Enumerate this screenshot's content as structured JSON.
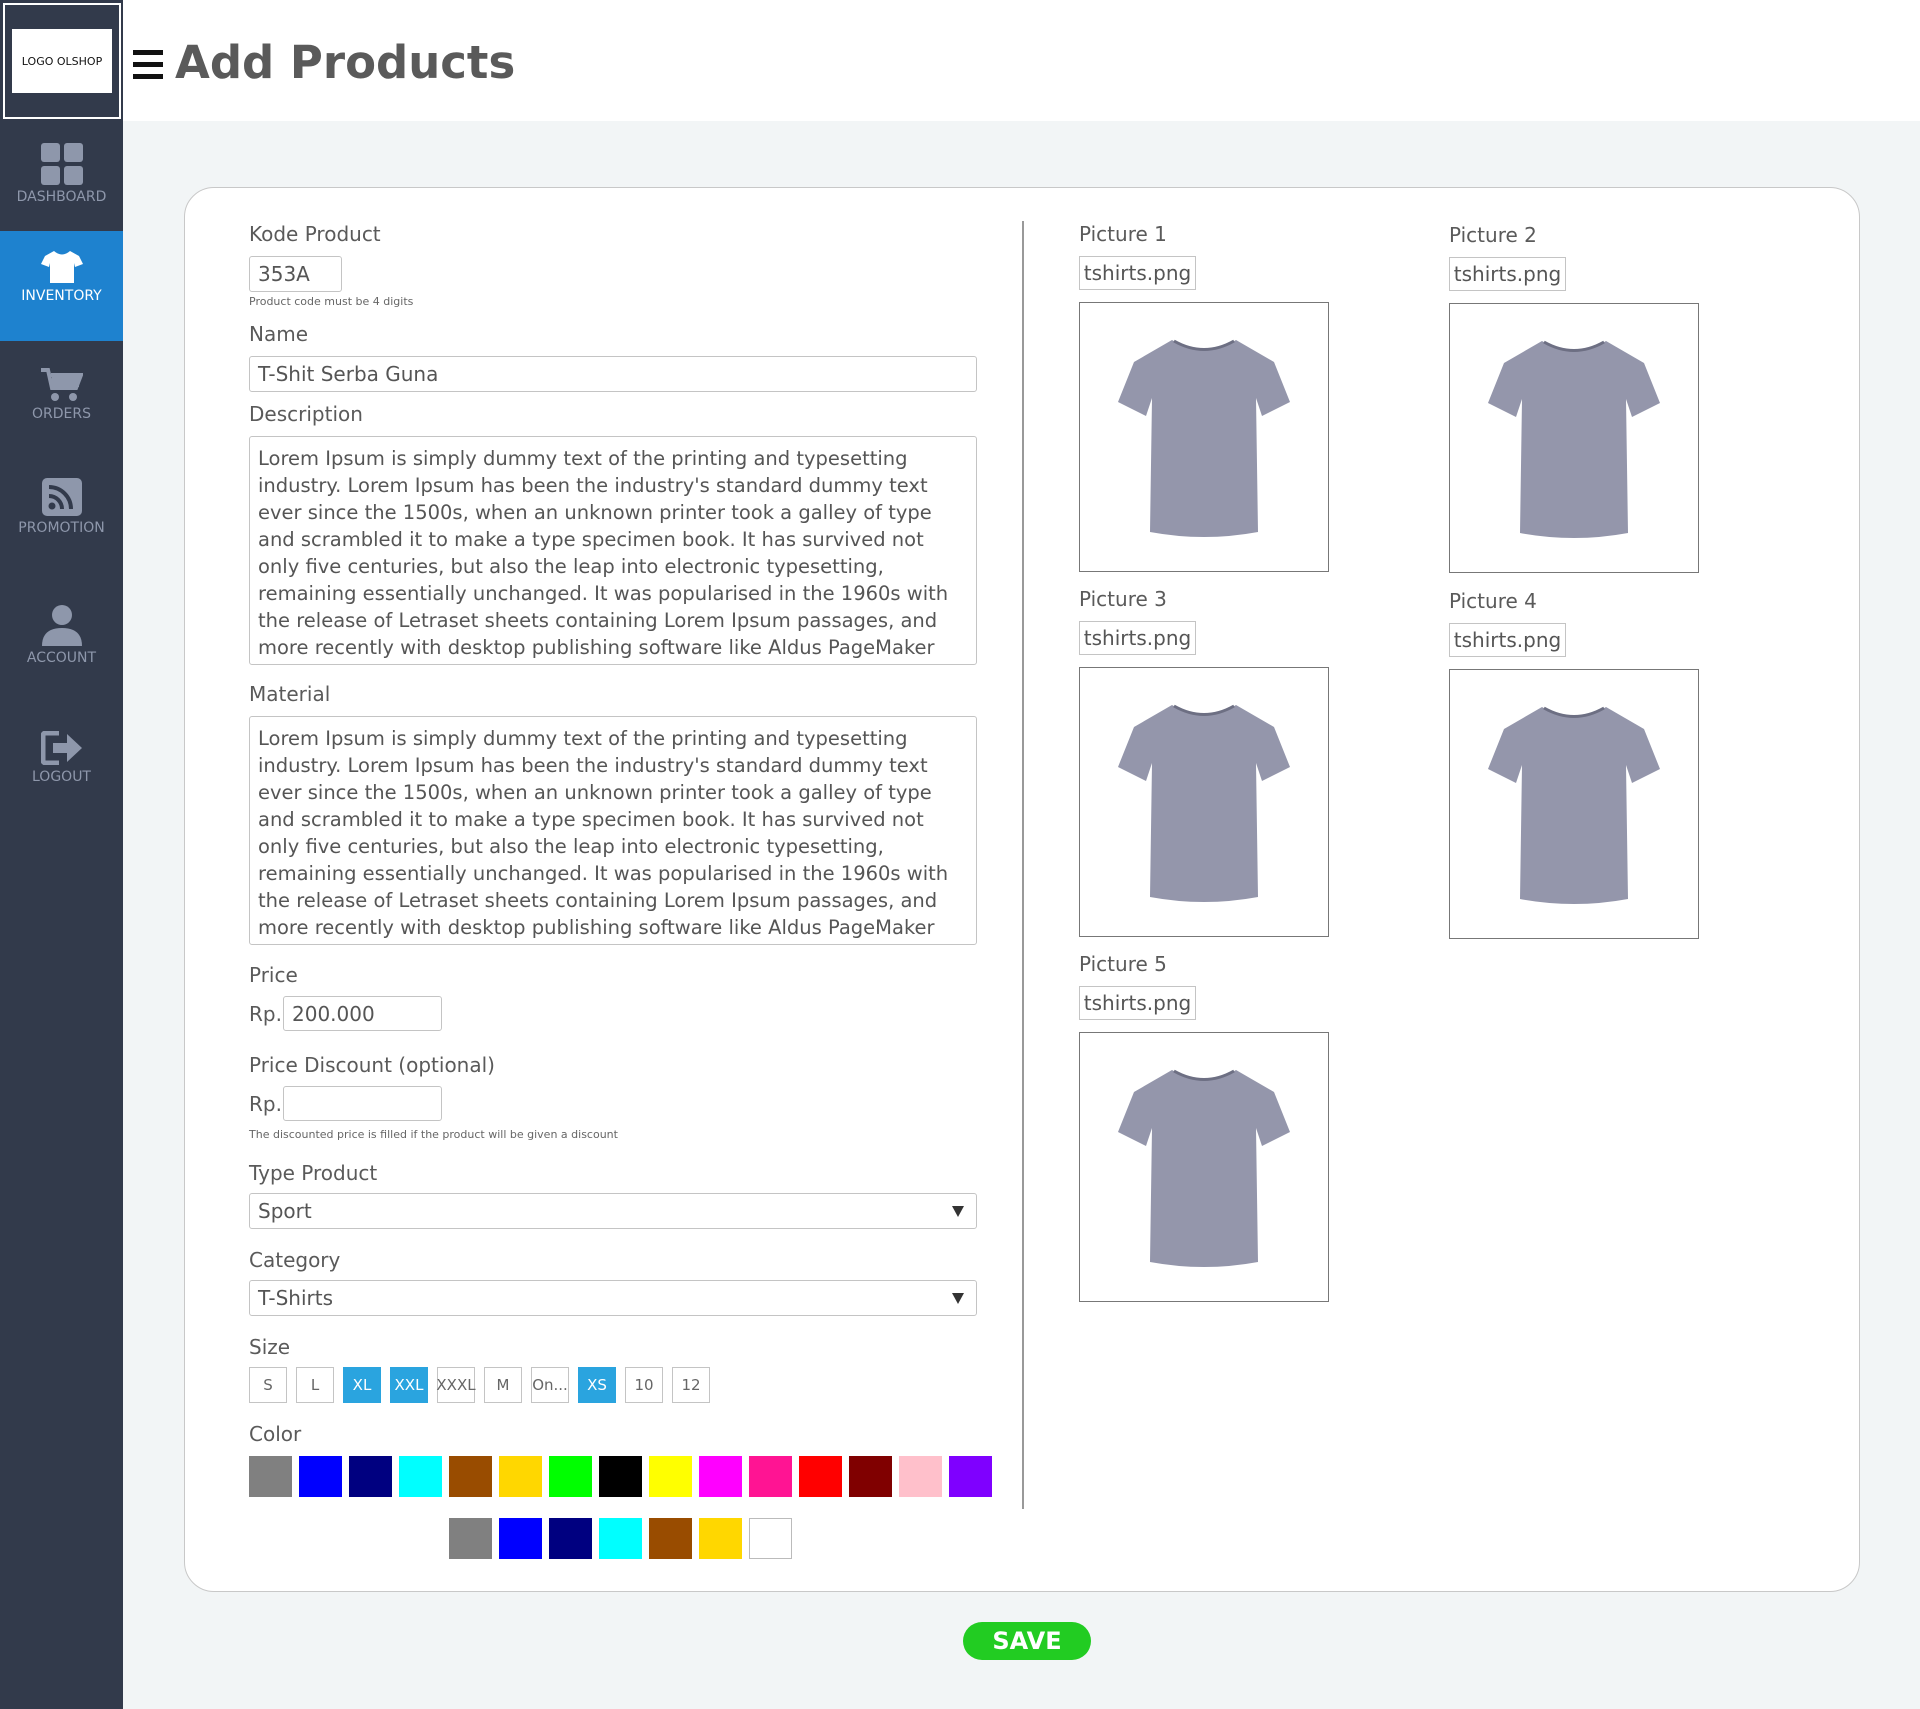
{
  "sidebar": {
    "logo": "LOGO OLSHOP",
    "items": [
      {
        "label": "DASHBOARD",
        "icon": "dashboard-icon"
      },
      {
        "label": "INVENTORY",
        "icon": "tshirt-icon",
        "active": true
      },
      {
        "label": "ORDERS",
        "icon": "cart-icon"
      },
      {
        "label": "PROMOTION",
        "icon": "rss-icon"
      },
      {
        "label": "ACCOUNT",
        "icon": "user-icon"
      },
      {
        "label": "LOGOUT",
        "icon": "logout-icon"
      }
    ]
  },
  "header": {
    "title": "Add Products"
  },
  "form": {
    "kode_label": "Kode Product",
    "kode_value": "353A",
    "kode_hint": "Product code must be 4 digits",
    "name_label": "Name",
    "name_value": "T-Shit Serba Guna",
    "description_label": "Description",
    "description_value": "Lorem Ipsum is simply dummy text of the printing and typesetting industry. Lorem Ipsum has been the industry's standard dummy text ever since the 1500s, when an unknown printer took a galley of type and scrambled it to make a type specimen book. It has survived not only five centuries, but also the leap into electronic typesetting, remaining essentially unchanged. It was popularised in the 1960s with the release of Letraset sheets containing Lorem Ipsum passages, and more recently with desktop publishing software like Aldus PageMaker",
    "material_label": "Material",
    "material_value": "Lorem Ipsum is simply dummy text of the printing and typesetting industry. Lorem Ipsum has been the industry's standard dummy text ever since the 1500s, when an unknown printer took a galley of type and scrambled it to make a type specimen book. It has survived not only five centuries, but also the leap into electronic typesetting, remaining essentially unchanged. It was popularised in the 1960s with the release of Letraset sheets containing Lorem Ipsum passages, and more recently with desktop publishing software like Aldus PageMaker",
    "price_label": "Price",
    "currency": "Rp.",
    "price_value": "200.000",
    "discount_label": "Price Discount (optional)",
    "discount_value": "",
    "discount_hint": "The discounted price is filled if the product will be given a discount",
    "type_label": "Type Product",
    "type_value": "Sport",
    "category_label": "Category",
    "category_value": "T-Shirts",
    "size_label": "Size",
    "sizes": [
      {
        "label": "S",
        "selected": false
      },
      {
        "label": "L",
        "selected": false
      },
      {
        "label": "XL",
        "selected": true
      },
      {
        "label": "XXL",
        "selected": true
      },
      {
        "label": "XXXL",
        "selected": false
      },
      {
        "label": "M",
        "selected": false
      },
      {
        "label": "On...",
        "selected": false
      },
      {
        "label": "XS",
        "selected": true
      },
      {
        "label": "10",
        "selected": false
      },
      {
        "label": "12",
        "selected": false
      }
    ],
    "color_label": "Color",
    "colors_row1": [
      "#808080",
      "#0000ff",
      "#000080",
      "#00ffff",
      "#994c00",
      "#ffd700",
      "#00ff00",
      "#000000",
      "#ffff00",
      "#ff00ff",
      "#ff1493",
      "#ff0000",
      "#800000",
      "#ffc0cb",
      "#7f00ff"
    ],
    "colors_row2": [
      "#808080",
      "#0000ff",
      "#000080",
      "#00ffff",
      "#994c00",
      "#ffd700",
      "#ffffff"
    ]
  },
  "pictures": [
    {
      "label": "Picture 1",
      "file": "tshirts.png"
    },
    {
      "label": "Picture 2",
      "file": "tshirts.png"
    },
    {
      "label": "Picture 3",
      "file": "tshirts.png"
    },
    {
      "label": "Picture 4",
      "file": "tshirts.png"
    },
    {
      "label": "Picture 5",
      "file": "tshirts.png"
    }
  ],
  "save_label": "SAVE"
}
